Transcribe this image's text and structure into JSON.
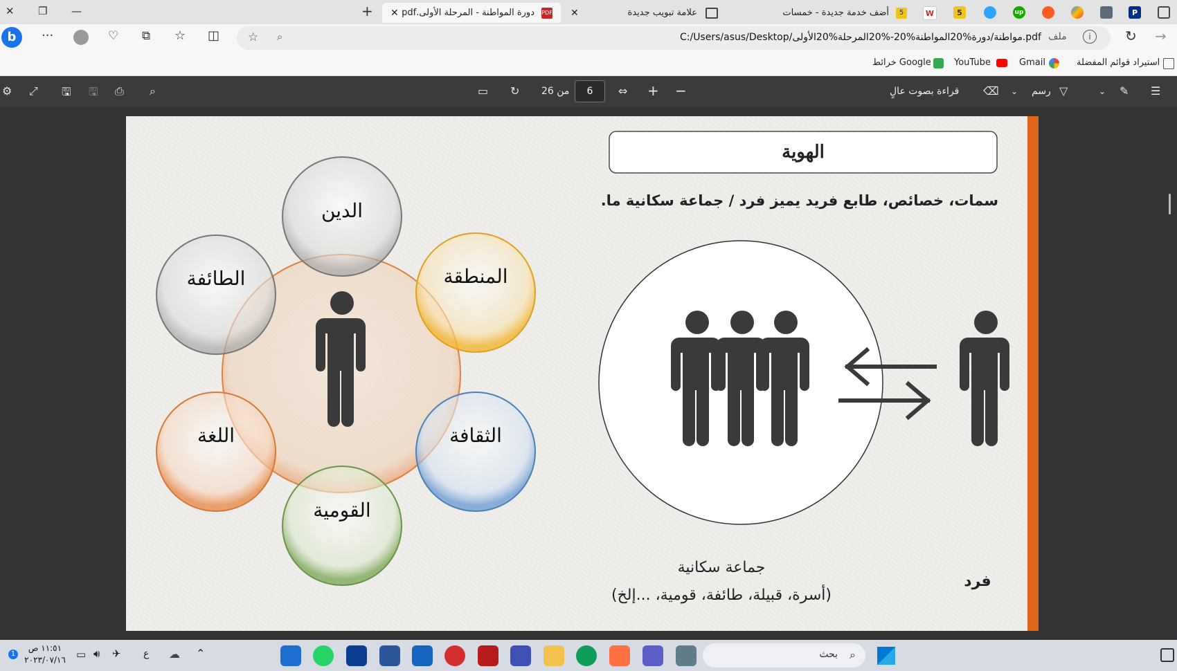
{
  "browser": {
    "tabs": [
      {
        "title": "دورة المواطنة - المرحلة الأولى.pdf",
        "active": true
      },
      {
        "title": "علامة تبويب جديدة",
        "active": false
      },
      {
        "title": "أضف خدمة جديدة - خمسات",
        "active": false
      }
    ],
    "url": "C:/Users/asus/Desktop/مواطنة/دورة%20المواطنة%20-%20المرحلة%20الأولى.pdf",
    "file_label": "ملف",
    "favorites": [
      {
        "label": "استيراد قوائم المفضلة"
      },
      {
        "label": "Gmail"
      },
      {
        "label": "YouTube"
      },
      {
        "label": "خرائط Google"
      }
    ]
  },
  "pdf_toolbar": {
    "read_aloud": "قراءة بصوت عالٍ",
    "draw": "رسم",
    "current_page": "6",
    "page_total": "من 26"
  },
  "slide": {
    "title": "الهوية",
    "definition": "سمات، خصائص، طابع فريد يميز فرد / جماعة سكانية ما.",
    "group_label": "جماعة سكانية",
    "group_examples": "(أسرة، قبيلة، طائفة، قومية، ...إلخ)",
    "individual_label": "فرد",
    "components": [
      {
        "label": "الدين",
        "color": "#c9c9c9"
      },
      {
        "label": "المنطقة",
        "color": "#f2b630"
      },
      {
        "label": "الثقافة",
        "color": "#8fb4dc"
      },
      {
        "label": "القومية",
        "color": "#8fb56a"
      },
      {
        "label": "اللغة",
        "color": "#f0a878"
      },
      {
        "label": "الطائفة",
        "color": "#c9c9c9"
      }
    ],
    "center_color": "#f0a878",
    "accent_color": "#e0661c"
  },
  "taskbar": {
    "search_label": "بحث",
    "time": "١١:٥١ ص",
    "date": "٢٠٢٣/٠٧/١٦",
    "lang": "ع"
  }
}
